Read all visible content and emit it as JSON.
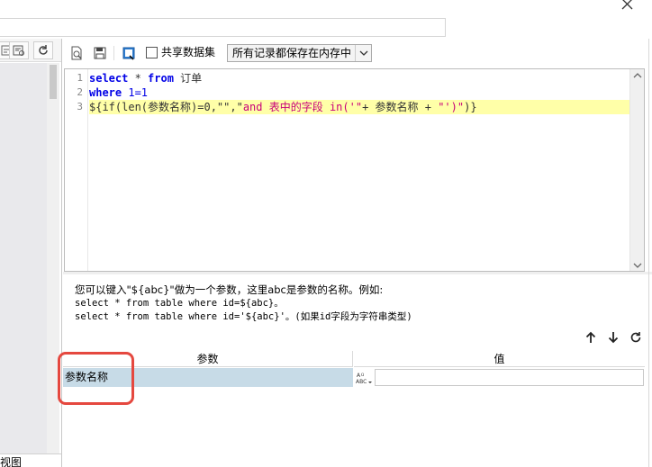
{
  "left_panel": {
    "view_label": "视图"
  },
  "toolbar": {
    "share_label": "共享数据集",
    "memory_option": "所有记录都保存在内存中"
  },
  "editor": {
    "lines": [
      {
        "number": "1",
        "tokens": [
          {
            "t": "select",
            "c": "kw"
          },
          {
            "t": " * ",
            "c": "op"
          },
          {
            "t": "from",
            "c": "kw"
          },
          {
            "t": " 订单",
            "c": "op"
          }
        ]
      },
      {
        "number": "2",
        "tokens": [
          {
            "t": "where",
            "c": "kw"
          },
          {
            "t": " 1=1",
            "c": "num"
          }
        ]
      },
      {
        "number": "3",
        "tokens": [
          {
            "t": "${if(len(参数名称)=0,\"\",\"",
            "c": "op"
          },
          {
            "t": "and 表中的字段 in('\"",
            "c": "str"
          },
          {
            "t": "+ 参数名称 + ",
            "c": "op"
          },
          {
            "t": "\"')\"",
            "c": "str"
          },
          {
            "t": ")}",
            "c": "op"
          }
        ]
      }
    ]
  },
  "hint": {
    "line1": "您可以键入\"${abc}\"做为一个参数，这里abc是参数的名称。例如:",
    "line2": "select * from table where id=${abc}。",
    "line3": "select * from table where id='${abc}'。(如果id字段为字符串类型)"
  },
  "params": {
    "header_param": "参数",
    "header_value": "值",
    "rows": [
      {
        "name": "参数名称",
        "value": ""
      }
    ]
  },
  "colors": {
    "highlight": "#ffffa8",
    "keyword": "#0000e6",
    "string": "#c8007a",
    "selected_row": "#c7dbe7",
    "annotation_box": "#e5483f"
  }
}
